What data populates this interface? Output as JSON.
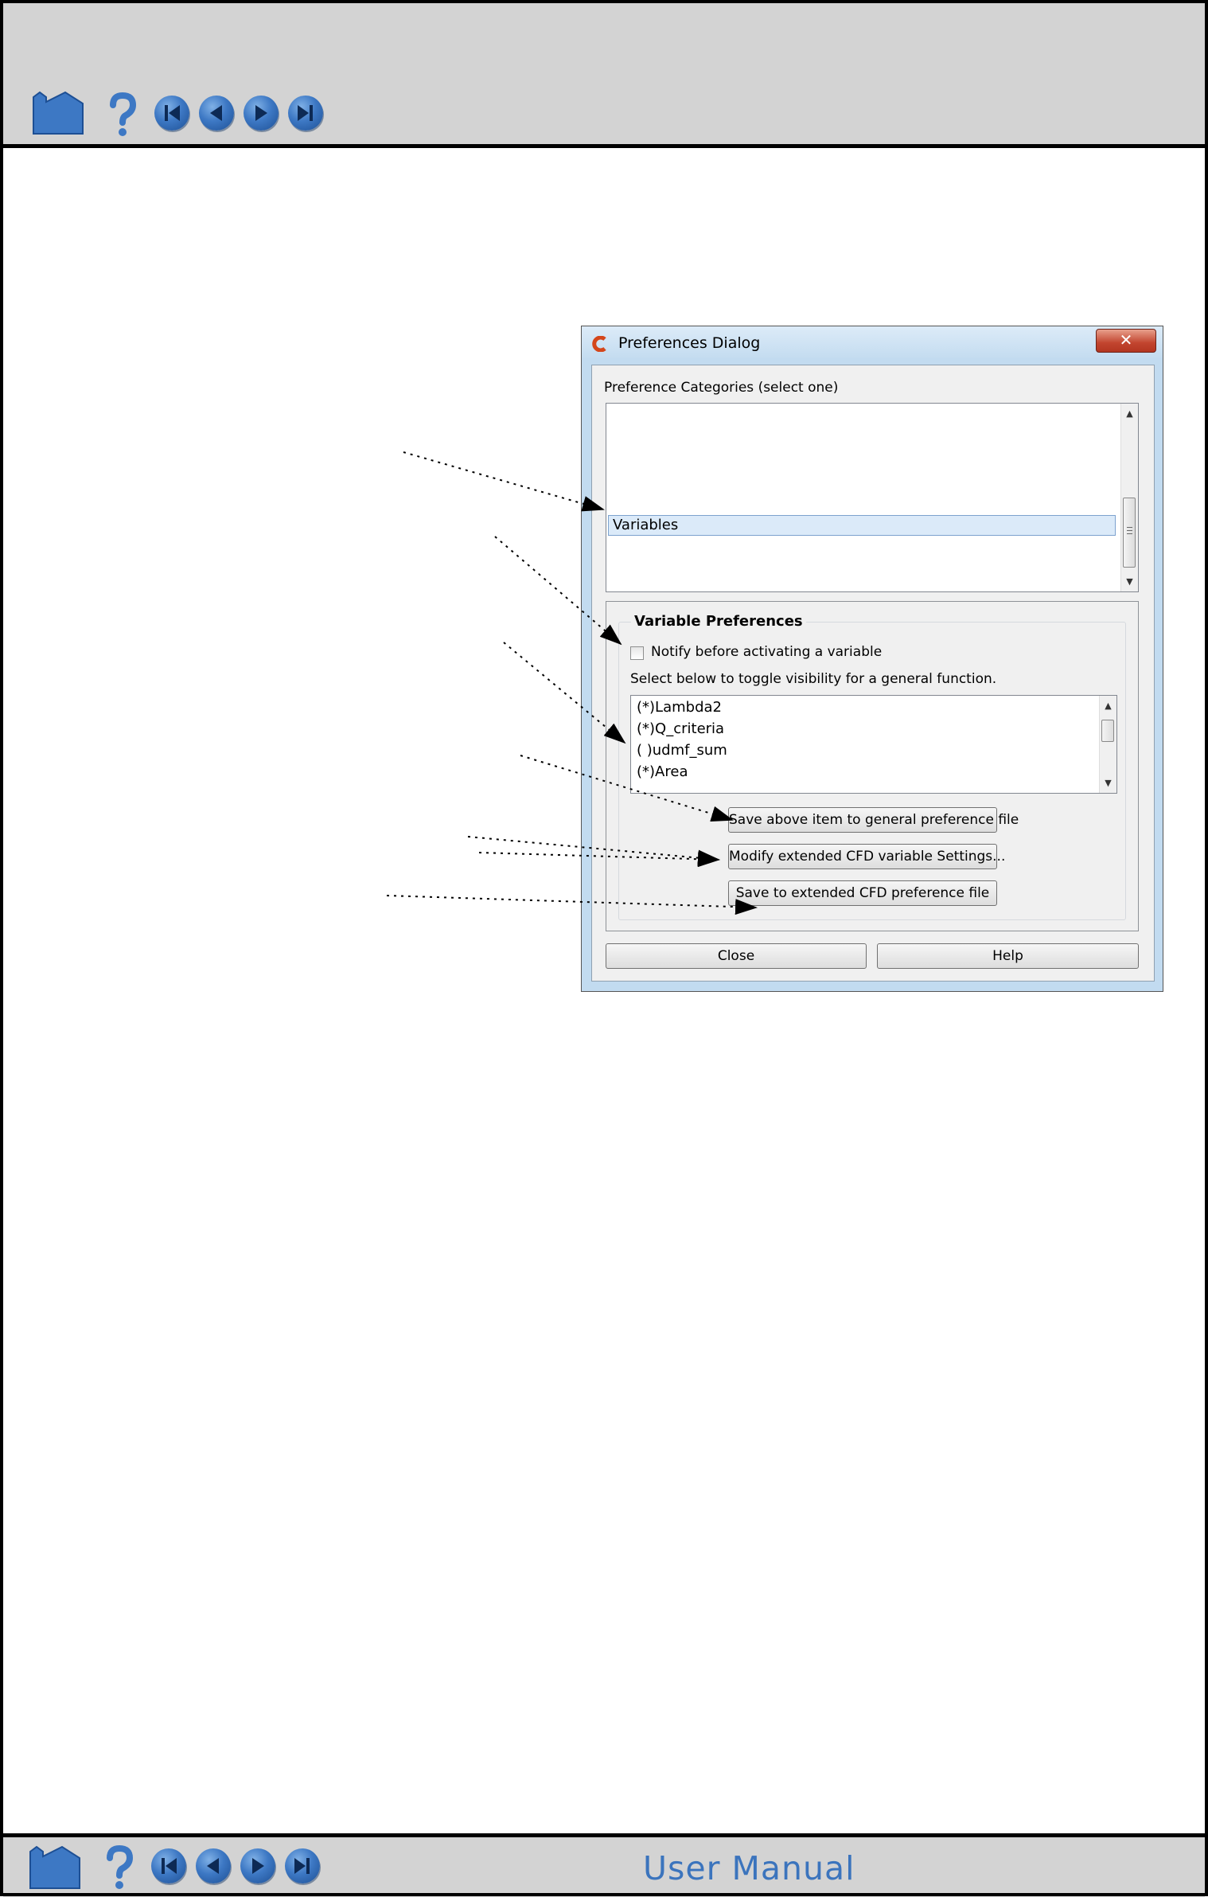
{
  "footer": {
    "title": "User Manual"
  },
  "dialog": {
    "title": "Preferences Dialog",
    "close_label": "✕",
    "categories_label": "Preference Categories (select one)",
    "selected_category": "Variables",
    "group_title": "Variable Preferences",
    "notify_label": "Notify before activating a variable",
    "toggle_hint": "Select below to toggle visibility for a general function.",
    "variables": [
      "(*)Lambda2",
      "(*)Q_criteria",
      "( )udmf_sum",
      "(*)Area"
    ],
    "save_general_label": "Save above item to general preference file",
    "modify_cfd_label": "Modify extended CFD variable Settings...",
    "save_cfd_label": "Save to extended CFD preference file",
    "close_button_label": "Close",
    "help_button_label": "Help"
  },
  "colors": {
    "toolbar_bg": "#d3d3d3",
    "icon_blue": "#3d78c4",
    "footer_text": "#3b74bd"
  },
  "icons": [
    "home-icon",
    "help-icon",
    "first-page-icon",
    "previous-page-icon",
    "next-page-icon",
    "last-page-icon"
  ]
}
